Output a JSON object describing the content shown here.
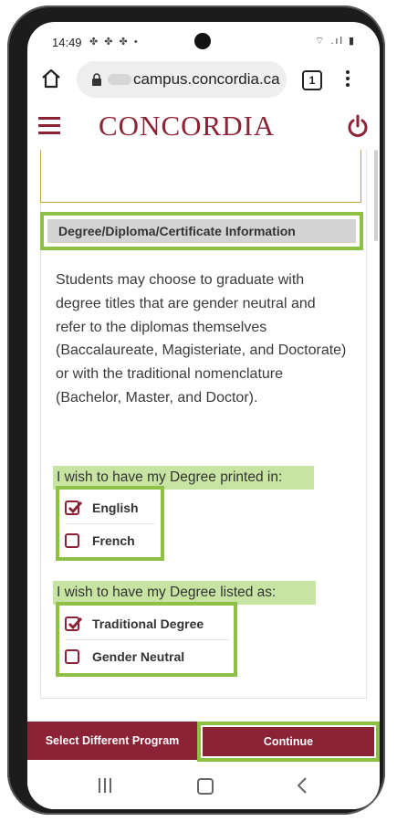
{
  "status_bar": {
    "time": "14:49",
    "left_icons": "✤ ✤ ✤ •",
    "right_icons": "⌔ .ıl ▮"
  },
  "browser": {
    "url": "campus.concordia.ca",
    "tabs_count": "1"
  },
  "header": {
    "logo_text": "CONCORDIA",
    "brand_color": "#8c2236"
  },
  "section": {
    "title": "Degree/Diploma/Certificate Information"
  },
  "description": "Students may choose to graduate with degree titles that are gender neutral and refer to the diplomas themselves (Baccalaureate, Magisteriate, and Doctorate) or with the traditional nomenclature (Bachelor, Master, and Doctor).",
  "language_prompt": "I wish to have my Degree printed in:",
  "language_options": [
    {
      "label": "English",
      "checked": true
    },
    {
      "label": "French",
      "checked": false
    }
  ],
  "listing_prompt": "I wish to have my Degree listed as:",
  "listing_options": [
    {
      "label": "Traditional Degree",
      "checked": true
    },
    {
      "label": "Gender Neutral",
      "checked": false
    }
  ],
  "footer": {
    "select_label": "Select Different Program",
    "continue_label": "Continue"
  },
  "highlight_color": "#8dc044"
}
